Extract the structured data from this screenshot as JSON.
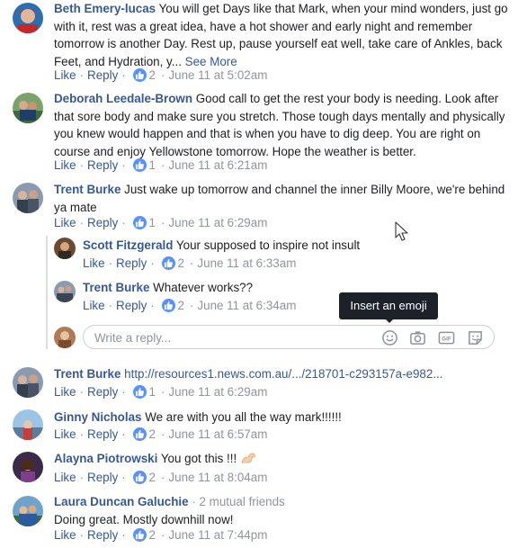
{
  "labels": {
    "like": "Like",
    "reply": "Reply"
  },
  "comments": [
    {
      "author": "Beth Emery-lucas",
      "text": "You will get Days like that Mark, when your mind wonders, just go with it, rest was a great idea, have a hot shower and early night and remember tomorrow is another Day. Rest up, pause yourself eat well, take care of Ankles, back Feet, and Hydration, y...",
      "see_more": "See More",
      "likes": "2",
      "date": "June 11 at 5:02am"
    },
    {
      "author": "Deborah Leedale-Brown",
      "text": "Good call to get the rest your body is needing. Look after that sore body and make sure you stretch. Those tough days mentally and physically you knew would happen and that is when you have to dig deep. You are right on course and enjoy Yellowstone tomorrow. Hope the weather is better.",
      "likes": "1",
      "date": "June 11 at 6:21am"
    },
    {
      "author": "Trent Burke",
      "text": "Just wake up tomorrow and channel the inner Billy Moore, we're behind ya mate",
      "likes": "1",
      "date": "June 11 at 6:29am",
      "replies": [
        {
          "author": "Scott Fitzgerald",
          "text": "Your supposed to inspire not insult",
          "likes": "2",
          "date": "June 11 at 6:33am"
        },
        {
          "author": "Trent Burke",
          "text": "Whatever works??",
          "likes": "2",
          "date": "June 11 at 6:34am"
        }
      ]
    },
    {
      "author": "Trent Burke",
      "link": "http://resources1.news.com.au/.../218701-c293157a-e982...",
      "likes": "1",
      "date": "June 11 at 6:29am"
    },
    {
      "author": "Ginny Nicholas",
      "text": "We are with you all the way mark!!!!!!",
      "likes": "2",
      "date": "June 11 at 6:57am"
    },
    {
      "author": "Alayna Piotrowski",
      "text": "You got this !!!",
      "likes": "2",
      "date": "June 11 at 8:04am"
    },
    {
      "author": "Laura Duncan Galuchie",
      "mutual": "· 2 mutual friends",
      "text": "Doing great. Mostly downhill now!",
      "likes": "2",
      "date": "June 11 at 7:44pm"
    }
  ],
  "reply_box": {
    "placeholder": "Write a reply..."
  },
  "tooltip": "Insert an emoji",
  "icons": [
    "like-reaction-icon",
    "emoji-icon",
    "camera-icon",
    "gif-icon",
    "sticker-icon",
    "flexed-arm-emoji",
    "mouse-cursor-icon"
  ],
  "colors": {
    "link": "#365899",
    "meta": "#90949c",
    "like_badge": "#5890ff",
    "tooltip_bg": "#1d2129"
  }
}
